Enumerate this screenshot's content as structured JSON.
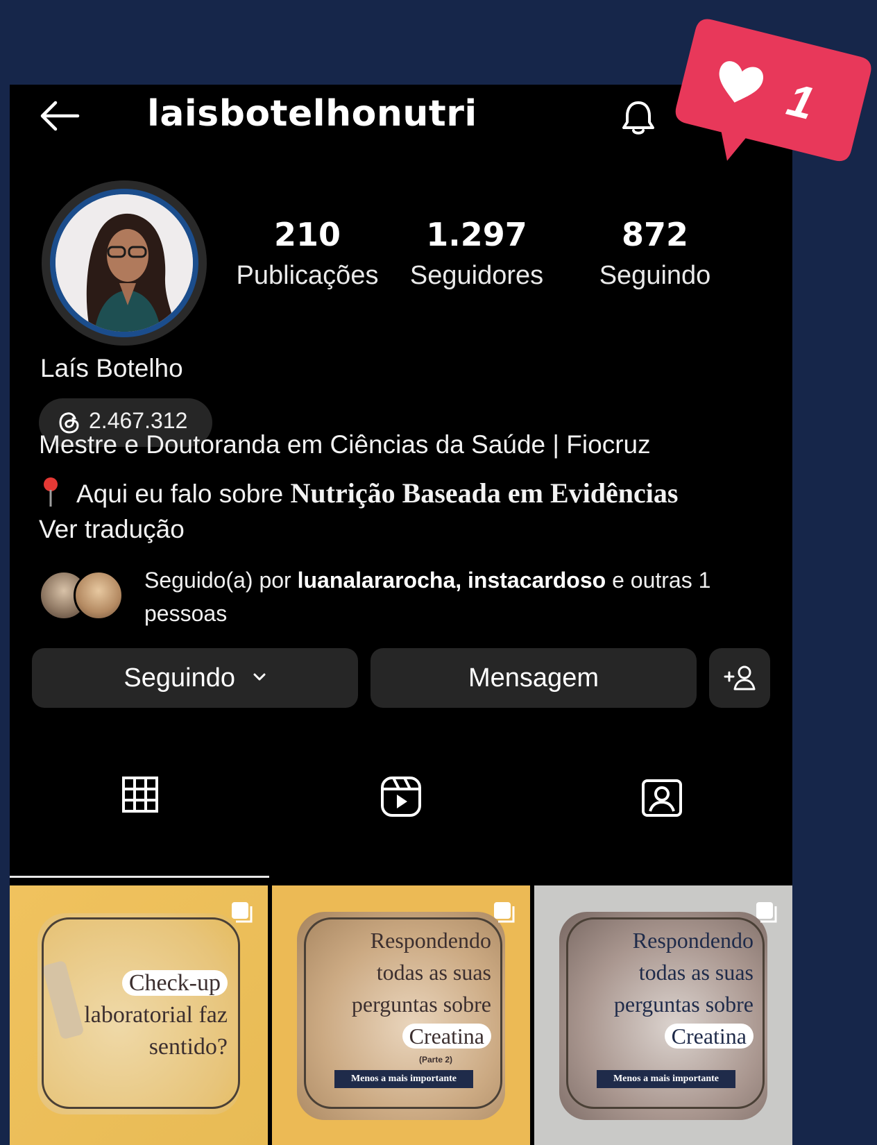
{
  "header": {
    "username": "laisbotelhonutri"
  },
  "notification": {
    "count": "1",
    "color": "#e8385a"
  },
  "profile": {
    "stats": [
      {
        "value": "210",
        "label": "Publicações"
      },
      {
        "value": "1.297",
        "label": "Seguidores"
      },
      {
        "value": "872",
        "label": "Seguindo"
      }
    ],
    "full_name": "Laís Botelho",
    "threads_count": "2.467.312",
    "bio_line1": "Mestre e Doutoranda em Ciências da Saúde | Fiocruz",
    "bio_line2_prefix": "Aqui eu falo sobre",
    "bio_line2_bold": "Nutrição Baseada em Evidências",
    "translate": "Ver tradução",
    "followed_prefix": "Seguido(a) por",
    "followed_user1": "luanalararocha",
    "followed_user2": "instacardoso",
    "followed_suffix": "e outras 1 pessoas"
  },
  "actions": {
    "following_label": "Seguindo",
    "message_label": "Mensagem"
  },
  "posts": [
    {
      "line1": "Check-up",
      "line2": "laboratorial faz",
      "line3": "sentido?"
    },
    {
      "line1": "Respondendo",
      "line2": "todas as suas",
      "line3": "perguntas sobre",
      "line4": "Creatina",
      "sub": "(Parte 2)",
      "tag": "Menos a mais importante"
    },
    {
      "line1": "Respondendo",
      "line2": "todas as suas",
      "line3": "perguntas sobre",
      "line4": "Creatina",
      "tag": "Menos a mais importante"
    }
  ]
}
